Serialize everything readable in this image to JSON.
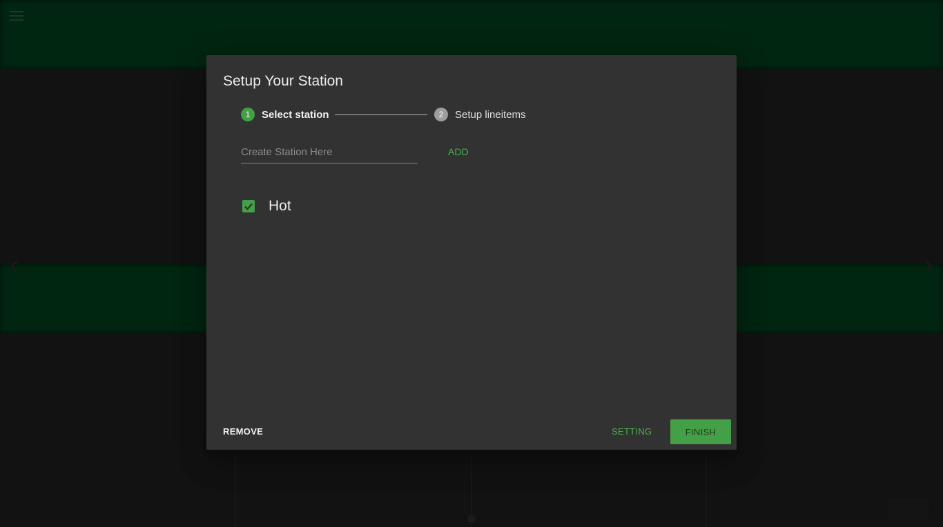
{
  "dialog": {
    "title": "Setup Your Station",
    "stepper": {
      "steps": [
        {
          "number": "1",
          "label": "Select station",
          "state": "active"
        },
        {
          "number": "2",
          "label": "Setup lineitems",
          "state": "inactive"
        }
      ]
    },
    "station_input": {
      "placeholder": "Create Station Here",
      "value": ""
    },
    "add_label": "ADD",
    "stations": [
      {
        "label": "Hot",
        "checked": true
      }
    ],
    "actions": {
      "remove_label": "REMOVE",
      "setting_label": "SETTING",
      "finish_label": "FINISH"
    }
  },
  "colors": {
    "accent": "#43a047",
    "accent_text": "#4caf50",
    "dialog_bg": "#323232",
    "app_band": "#003a1a",
    "app_bg": "#1c1c1c"
  }
}
